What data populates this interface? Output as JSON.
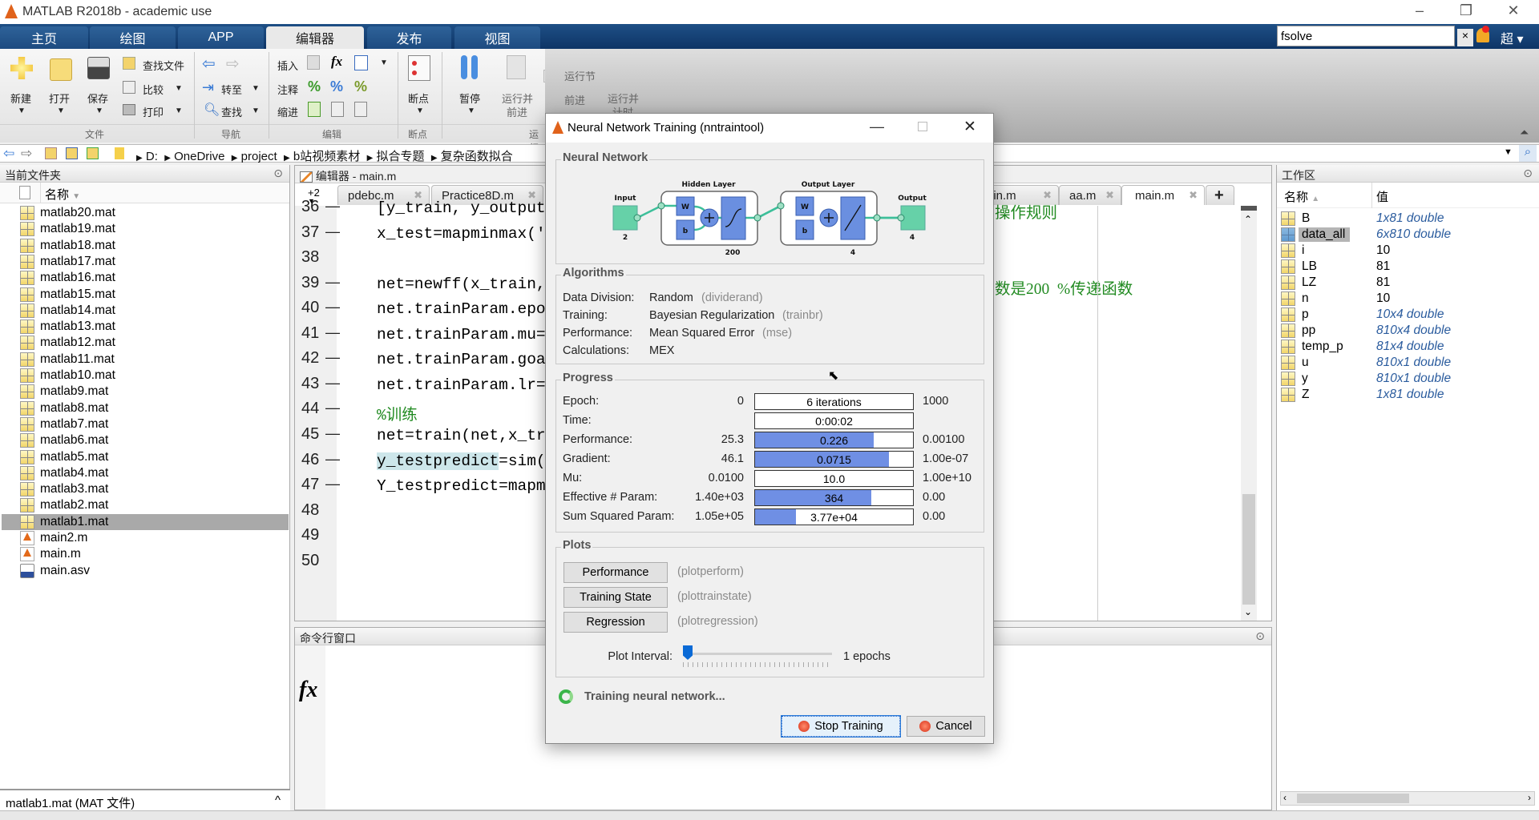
{
  "window": {
    "title": "MATLAB R2018b - academic use"
  },
  "ribbon": {
    "tabs": [
      "主页",
      "绘图",
      "APP",
      "编辑器",
      "发布",
      "视图"
    ],
    "active_tab": "编辑器",
    "file": {
      "new": "新建",
      "open": "打开",
      "save": "保存",
      "find_files": "查找文件",
      "compare": "比较",
      "print": "打印",
      "group": "文件"
    },
    "nav": {
      "goto": "转至",
      "find": "查找",
      "group": "导航"
    },
    "edit": {
      "insert": "插入",
      "comment": "注释",
      "indent": "缩进",
      "group": "编辑",
      "fx": "fx"
    },
    "breakpoints": {
      "label": "断点",
      "group": "断点"
    },
    "run": {
      "pause": "暂停",
      "run_advance_1": "运行并",
      "run_advance_2": "前进",
      "run_section": "运行节",
      "advance": "前进",
      "run_time_1": "运行并",
      "run_time_2": "计时",
      "group": "运行"
    }
  },
  "search": {
    "value": "fsolve",
    "user": "超"
  },
  "breadcrumb": [
    "D:",
    "OneDrive",
    "project",
    "b站视频素材",
    "拟合专题",
    "复杂函数拟合"
  ],
  "current_folder": {
    "title": "当前文件夹",
    "column": "名称",
    "files": [
      {
        "name": "matlab20.mat",
        "type": "mat"
      },
      {
        "name": "matlab19.mat",
        "type": "mat"
      },
      {
        "name": "matlab18.mat",
        "type": "mat"
      },
      {
        "name": "matlab17.mat",
        "type": "mat"
      },
      {
        "name": "matlab16.mat",
        "type": "mat"
      },
      {
        "name": "matlab15.mat",
        "type": "mat"
      },
      {
        "name": "matlab14.mat",
        "type": "mat"
      },
      {
        "name": "matlab13.mat",
        "type": "mat"
      },
      {
        "name": "matlab12.mat",
        "type": "mat"
      },
      {
        "name": "matlab11.mat",
        "type": "mat"
      },
      {
        "name": "matlab10.mat",
        "type": "mat"
      },
      {
        "name": "matlab9.mat",
        "type": "mat"
      },
      {
        "name": "matlab8.mat",
        "type": "mat"
      },
      {
        "name": "matlab7.mat",
        "type": "mat"
      },
      {
        "name": "matlab6.mat",
        "type": "mat"
      },
      {
        "name": "matlab5.mat",
        "type": "mat"
      },
      {
        "name": "matlab4.mat",
        "type": "mat"
      },
      {
        "name": "matlab3.mat",
        "type": "mat"
      },
      {
        "name": "matlab2.mat",
        "type": "mat"
      },
      {
        "name": "matlab1.mat",
        "type": "mat",
        "selected": true
      },
      {
        "name": "main2.m",
        "type": "m"
      },
      {
        "name": "main.m",
        "type": "m"
      },
      {
        "name": "main.asv",
        "type": "asv"
      }
    ],
    "details": "matlab1.mat  (MAT 文件)"
  },
  "editor": {
    "title": "编辑器 - main.m",
    "tab_overflow": "+2",
    "tabs": [
      {
        "label": "pdebc.m"
      },
      {
        "label": "Practice8D.m"
      },
      {
        "label": "ain.m"
      },
      {
        "label": "aa.m"
      },
      {
        "label": "main.m",
        "active": true
      }
    ],
    "lines": [
      {
        "n": "36",
        "code": "[y_train, y_output]",
        "right": "操作规则"
      },
      {
        "n": "37",
        "code": "x_test=mapminmax('"
      },
      {
        "n": "38",
        "code": ""
      },
      {
        "n": "39",
        "code": "net=newff(x_train,",
        "right": "数是200  %传递函数"
      },
      {
        "n": "40",
        "code": "net.trainParam.epo"
      },
      {
        "n": "41",
        "code": "net.trainParam.mu="
      },
      {
        "n": "42",
        "code": "net.trainParam.goa"
      },
      {
        "n": "43",
        "code": "net.trainParam.lr="
      },
      {
        "n": "44",
        "code": "%训练",
        "comment": true
      },
      {
        "n": "45",
        "code": "net=train(net,x_tr"
      },
      {
        "n": "46",
        "code": "=sim(",
        "highlight": "y_testpredict"
      },
      {
        "n": "47",
        "code": "Y_testpredict=mapm"
      },
      {
        "n": "48",
        "code": ""
      },
      {
        "n": "49",
        "code": ""
      },
      {
        "n": "50",
        "code": ""
      }
    ]
  },
  "command_window": {
    "title": "命令行窗口",
    "prompt": "fx"
  },
  "workspace": {
    "title": "工作区",
    "col_name": "名称",
    "col_value": "值",
    "vars": [
      {
        "name": "B",
        "value": "1x81 double",
        "italic": true
      },
      {
        "name": "data_all",
        "value": "6x810 double",
        "italic": true,
        "selected": true
      },
      {
        "name": "i",
        "value": "10"
      },
      {
        "name": "LB",
        "value": "81"
      },
      {
        "name": "LZ",
        "value": "81"
      },
      {
        "name": "n",
        "value": "10"
      },
      {
        "name": "p",
        "value": "10x4 double",
        "italic": true
      },
      {
        "name": "pp",
        "value": "810x4 double",
        "italic": true
      },
      {
        "name": "temp_p",
        "value": "81x4 double",
        "italic": true
      },
      {
        "name": "u",
        "value": "810x1 double",
        "italic": true
      },
      {
        "name": "y",
        "value": "810x1 double",
        "italic": true
      },
      {
        "name": "Z",
        "value": "1x81 double",
        "italic": true
      }
    ]
  },
  "dialog": {
    "title": "Neural Network Training (nntraintool)",
    "network": {
      "title": "Neural Network",
      "input": "Input",
      "input_size": "2",
      "hidden": "Hidden Layer",
      "hidden_size": "200",
      "output_layer": "Output Layer",
      "output_layer_size": "4",
      "output": "Output",
      "output_size": "4",
      "w": "W",
      "b": "b"
    },
    "algorithms": {
      "title": "Algorithms",
      "rows": [
        {
          "label": "Data Division:",
          "value": "Random",
          "fn": "(dividerand)"
        },
        {
          "label": "Training:",
          "value": "Bayesian Regularization",
          "fn": "(trainbr)"
        },
        {
          "label": "Performance:",
          "value": "Mean Squared Error",
          "fn": "(mse)"
        },
        {
          "label": "Calculations:",
          "value": "MEX",
          "fn": ""
        }
      ]
    },
    "progress": {
      "title": "Progress",
      "rows": [
        {
          "label": "Epoch:",
          "start": "0",
          "current": "6 iterations",
          "end": "1000",
          "fill": 0
        },
        {
          "label": "Time:",
          "start": "",
          "current": "0:00:02",
          "end": "",
          "fill": 0
        },
        {
          "label": "Performance:",
          "start": "25.3",
          "current": "0.226",
          "end": "0.00100",
          "fill": 0.75
        },
        {
          "label": "Gradient:",
          "start": "46.1",
          "current": "0.0715",
          "end": "1.00e-07",
          "fill": 0.85
        },
        {
          "label": "Mu:",
          "start": "0.0100",
          "current": "10.0",
          "end": "1.00e+10",
          "fill": 0
        },
        {
          "label": "Effective # Param:",
          "start": "1.40e+03",
          "current": "364",
          "end": "0.00",
          "fill": 0.735
        },
        {
          "label": "Sum Squared Param:",
          "start": "1.05e+05",
          "current": "3.77e+04",
          "end": "0.00",
          "fill": 0.26
        }
      ]
    },
    "plots": {
      "title": "Plots",
      "buttons": [
        {
          "label": "Performance",
          "fn": "(plotperform)"
        },
        {
          "label": "Training State",
          "fn": "(plottrainstate)"
        },
        {
          "label": "Regression",
          "fn": "(plotregression)"
        }
      ],
      "interval_label": "Plot Interval:",
      "interval_value": "1 epochs",
      "slider_fraction": 0
    },
    "status": "Training neural network...",
    "stop": "Stop Training",
    "cancel": "Cancel",
    "bar_color": "#6f8fe4"
  }
}
